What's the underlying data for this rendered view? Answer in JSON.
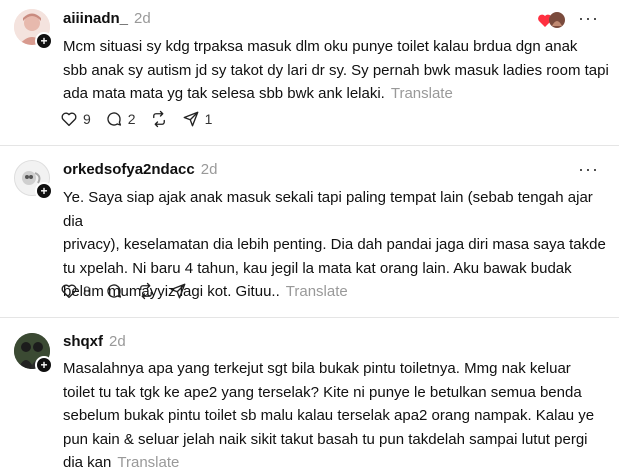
{
  "posts": [
    {
      "username": "aiiinadn_",
      "time": "2d",
      "body": "Mcm situasi sy kdg trpaksa masuk dlm oku punye toilet kalau brdua dgn anak\nsbb anak sy autism jd sy takot dy lari dr sy. Sy pernah bwk masuk ladies room tapi\nada mata mata yg tak selesa sbb bwk ank lelaki.",
      "translate": "Translate",
      "likes": "9",
      "replies": "2",
      "reposts": "",
      "shares": "1"
    },
    {
      "username": "orkedsofya2ndacc",
      "time": "2d",
      "body": "Ye. Saya siap ajak anak masuk sekali tapi paling tempat lain (sebab tengah ajar dia\nprivacy), keselamatan dia lebih penting. Dia dah pandai jaga diri masa saya takde\ntu xpelah. Ni baru 4 tahun, kau jegil la mata kat orang lain. Aku bawak budak\nbelum mumayyiz lagi kot. Gituu..",
      "translate": "Translate",
      "likes": "8",
      "replies": "",
      "reposts": "",
      "shares": ""
    },
    {
      "username": "shqxf",
      "time": "2d",
      "body": "Masalahnya apa yang terkejut sgt bila bukak pintu toiletnya. Mmg nak keluar\ntoilet tu tak tgk ke ape2 yang terselak? Kite ni punye le betulkan semua benda\nsebelum bukak pintu toilet sb malu kalau terselak apa2 orang nampak. Kalau ye\npun kain & seluar jelah naik sikit takut basah tu pun takdelah sampai lutut pergi\ndia kan",
      "translate": "Translate"
    }
  ],
  "icons": {
    "like": "heart-icon",
    "reply": "comment-icon",
    "repost": "repost-icon",
    "share": "send-icon",
    "more": "more-icon",
    "follow": "plus-icon"
  },
  "colors": {
    "text": "#101010",
    "muted": "#999999",
    "divider": "#e5e5e5",
    "heart": "#ff3040"
  }
}
